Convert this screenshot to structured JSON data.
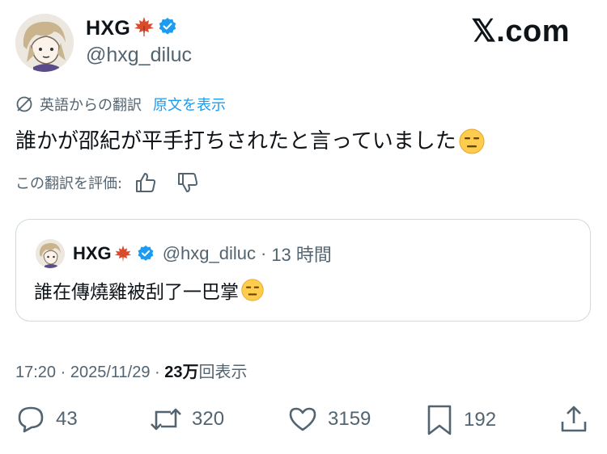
{
  "author": {
    "display_name": "HXG",
    "handle": "@hxg_diluc",
    "name_emoji_icon": "maple-leaf-icon",
    "verified_color": "#1d9bf0"
  },
  "brand": "𝕏.com",
  "translation": {
    "label": "英語からの翻訳",
    "show_original": "原文を表示",
    "rate_label": "この翻訳を評価:"
  },
  "tweet": {
    "text": "誰かが邵紀が平手打ちされたと言っていました",
    "emoji_icon": "expressionless-face-icon"
  },
  "quote": {
    "display_name": "HXG",
    "handle": "@hxg_diluc",
    "separator": "·",
    "time": "13 時間",
    "text": "誰在傳燒雞被刮了一巴掌"
  },
  "meta": {
    "time": "17:20",
    "sep1": " · ",
    "date": "2025/11/29",
    "sep2": " · ",
    "views_count": "23万",
    "views_label": "回表示"
  },
  "actions": {
    "replies": "43",
    "retweets": "320",
    "likes": "3159",
    "bookmarks": "192"
  },
  "colors": {
    "text": "#0f1419",
    "secondary": "#536471",
    "link": "#1d9bf0",
    "border": "#cfd9de"
  }
}
